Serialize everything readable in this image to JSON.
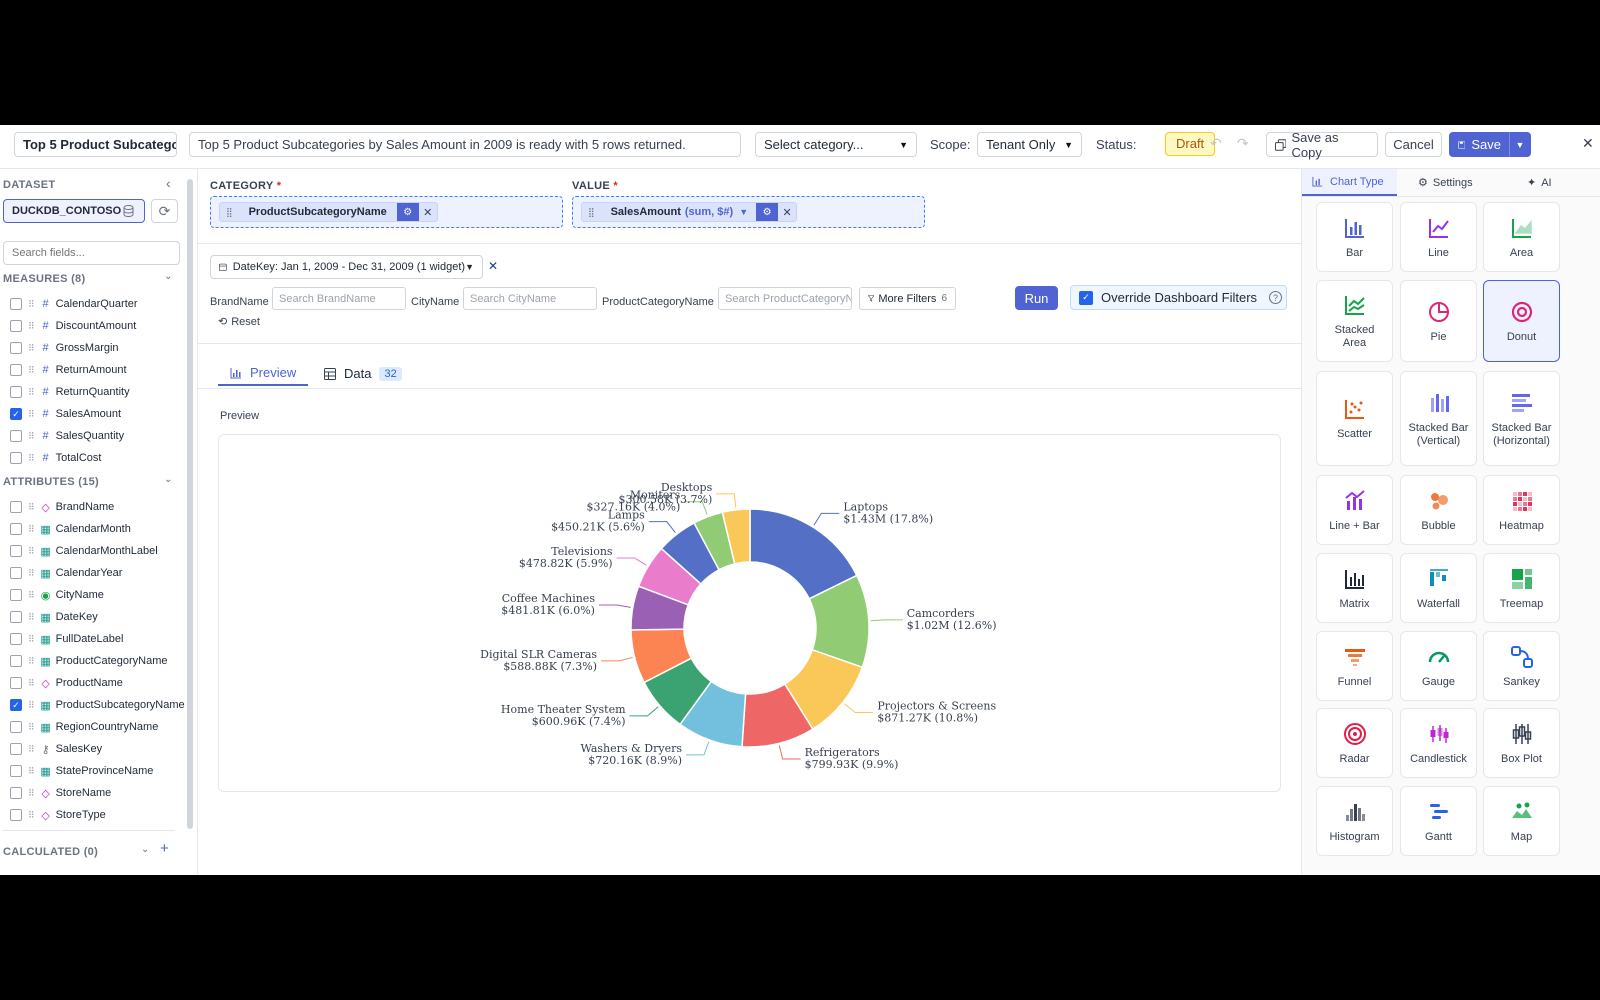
{
  "topbar": {
    "title_value": "Top 5 Product Subcatego",
    "description_value": "Top 5 Product Subcategories by Sales Amount in 2009 is ready with 5 rows returned.",
    "category_select": "Select category...",
    "scope_label": "Scope:",
    "scope_value": "Tenant Only",
    "status_label": "Status:",
    "status_value": "Draft",
    "save_copy_label": "Save as Copy",
    "cancel_label": "Cancel",
    "save_label": "Save"
  },
  "sidebar": {
    "dataset_heading": "DATASET",
    "dataset_name": "DUCKDB_CONTOSO",
    "search_placeholder": "Search fields...",
    "measures_heading": "MEASURES (8)",
    "measures": [
      {
        "name": "CalendarQuarter",
        "checked": false
      },
      {
        "name": "DiscountAmount",
        "checked": false
      },
      {
        "name": "GrossMargin",
        "checked": false
      },
      {
        "name": "ReturnAmount",
        "checked": false
      },
      {
        "name": "ReturnQuantity",
        "checked": false
      },
      {
        "name": "SalesAmount",
        "checked": true
      },
      {
        "name": "SalesQuantity",
        "checked": false
      },
      {
        "name": "TotalCost",
        "checked": false
      }
    ],
    "attributes_heading": "ATTRIBUTES (15)",
    "attributes": [
      {
        "name": "BrandName",
        "icon": "tag",
        "checked": false
      },
      {
        "name": "CalendarMonth",
        "icon": "calendar",
        "checked": false
      },
      {
        "name": "CalendarMonthLabel",
        "icon": "calendar",
        "checked": false
      },
      {
        "name": "CalendarYear",
        "icon": "calendar",
        "checked": false
      },
      {
        "name": "CityName",
        "icon": "location",
        "checked": false
      },
      {
        "name": "DateKey",
        "icon": "calendar",
        "checked": false
      },
      {
        "name": "FullDateLabel",
        "icon": "calendar",
        "checked": false
      },
      {
        "name": "ProductCategoryName",
        "icon": "calendar",
        "checked": false
      },
      {
        "name": "ProductName",
        "icon": "tag",
        "checked": false
      },
      {
        "name": "ProductSubcategoryName",
        "icon": "calendar",
        "checked": true
      },
      {
        "name": "RegionCountryName",
        "icon": "calendar",
        "checked": false
      },
      {
        "name": "SalesKey",
        "icon": "key",
        "checked": false
      },
      {
        "name": "StateProvinceName",
        "icon": "calendar",
        "checked": false
      },
      {
        "name": "StoreName",
        "icon": "tag",
        "checked": false
      },
      {
        "name": "StoreType",
        "icon": "tag",
        "checked": false
      }
    ],
    "calculated_heading": "CALCULATED (0)"
  },
  "builder": {
    "category_label": "CATEGORY",
    "category_field": "ProductSubcategoryName",
    "value_label": "VALUE",
    "value_field": "SalesAmount",
    "value_agg": "(sum, $#)",
    "date_filter": "DateKey: Jan 1, 2009 - Dec 31, 2009 (1 widget)",
    "filters": [
      {
        "label": "BrandName",
        "placeholder": "Search BrandName"
      },
      {
        "label": "CityName",
        "placeholder": "Search CityName"
      },
      {
        "label": "ProductCategoryName",
        "placeholder": "Search ProductCategoryN"
      }
    ],
    "more_filters_label": "More Filters",
    "more_filters_count": "6",
    "run_label": "Run",
    "override_label": "Override Dashboard Filters",
    "reset_label": "Reset",
    "tab_preview": "Preview",
    "tab_data": "Data",
    "data_count": "32",
    "preview_heading": "Preview"
  },
  "chart_data": {
    "type": "pie",
    "variant": "donut",
    "categories": [
      "Laptops",
      "Camcorders",
      "Projectors & Screens",
      "Refrigerators",
      "Washers & Dryers",
      "Home Theater System",
      "Digital SLR Cameras",
      "Coffee Machines",
      "Televisions",
      "Lamps",
      "Monitors",
      "Desktops"
    ],
    "values": [
      1430000,
      1020000,
      871270,
      799930,
      720160,
      600960,
      588880,
      481810,
      478820,
      450210,
      327160,
      300580
    ],
    "value_labels": [
      "$1.43M (17.8%)",
      "$1.02M (12.6%)",
      "$871.27K (10.8%)",
      "$799.93K (9.9%)",
      "$720.16K (8.9%)",
      "$600.96K (7.4%)",
      "$588.88K (7.3%)",
      "$481.81K (6.0%)",
      "$478.82K (5.9%)",
      "$450.21K (5.6%)",
      "$327.16K (4.0%)",
      "$300.58K (3.7%)"
    ],
    "percents": [
      17.8,
      12.6,
      10.8,
      9.9,
      8.9,
      7.4,
      7.3,
      6.0,
      5.9,
      5.6,
      4.0,
      3.7
    ],
    "colors": [
      "#5470c6",
      "#91cc75",
      "#fac858",
      "#ee6666",
      "#73c0de",
      "#3ba272",
      "#fc8452",
      "#9a60b4",
      "#ea7ccc",
      "#5470c6",
      "#91cc75",
      "#fac858"
    ]
  },
  "right_panel": {
    "tab_chart_type": "Chart Type",
    "tab_settings": "Settings",
    "tab_ai": "AI",
    "chart_types": [
      {
        "label": "Bar",
        "icon": "bar-chart-icon",
        "color": "#4f63d2"
      },
      {
        "label": "Line",
        "icon": "line-chart-icon",
        "color": "#9333ea"
      },
      {
        "label": "Area",
        "icon": "area-chart-icon",
        "color": "#16a34a"
      },
      {
        "label": "Stacked Area",
        "icon": "stacked-area-icon",
        "color": "#16a34a"
      },
      {
        "label": "Pie",
        "icon": "pie-chart-icon",
        "color": "#db2777"
      },
      {
        "label": "Donut",
        "icon": "donut-chart-icon",
        "color": "#db2777",
        "selected": true
      },
      {
        "label": "Scatter",
        "icon": "scatter-chart-icon",
        "color": "#ea580c"
      },
      {
        "label": "Stacked Bar (Vertical)",
        "icon": "stacked-bar-vertical-icon",
        "color": "#6366f1"
      },
      {
        "label": "Stacked Bar (Horizontal)",
        "icon": "stacked-bar-horizontal-icon",
        "color": "#6366f1"
      },
      {
        "label": "Line + Bar",
        "icon": "line-bar-icon",
        "color": "#9333ea"
      },
      {
        "label": "Bubble",
        "icon": "bubble-chart-icon",
        "color": "#ea580c"
      },
      {
        "label": "Heatmap",
        "icon": "heatmap-icon",
        "color": "#e11d48"
      },
      {
        "label": "Matrix",
        "icon": "matrix-icon",
        "color": "#1f2937"
      },
      {
        "label": "Waterfall",
        "icon": "waterfall-icon",
        "color": "#0891b2"
      },
      {
        "label": "Treemap",
        "icon": "treemap-icon",
        "color": "#16a34a"
      },
      {
        "label": "Funnel",
        "icon": "funnel-icon",
        "color": "#ea580c"
      },
      {
        "label": "Gauge",
        "icon": "gauge-icon",
        "color": "#059669"
      },
      {
        "label": "Sankey",
        "icon": "sankey-icon",
        "color": "#2563eb"
      },
      {
        "label": "Radar",
        "icon": "radar-icon",
        "color": "#e11d48"
      },
      {
        "label": "Candlestick",
        "icon": "candlestick-icon",
        "color": "#c026d3"
      },
      {
        "label": "Box Plot",
        "icon": "box-plot-icon",
        "color": "#374151"
      },
      {
        "label": "Histogram",
        "icon": "histogram-icon",
        "color": "#374151"
      },
      {
        "label": "Gantt",
        "icon": "gantt-icon",
        "color": "#2563eb"
      },
      {
        "label": "Map",
        "icon": "map-icon",
        "color": "#16a34a"
      }
    ]
  }
}
